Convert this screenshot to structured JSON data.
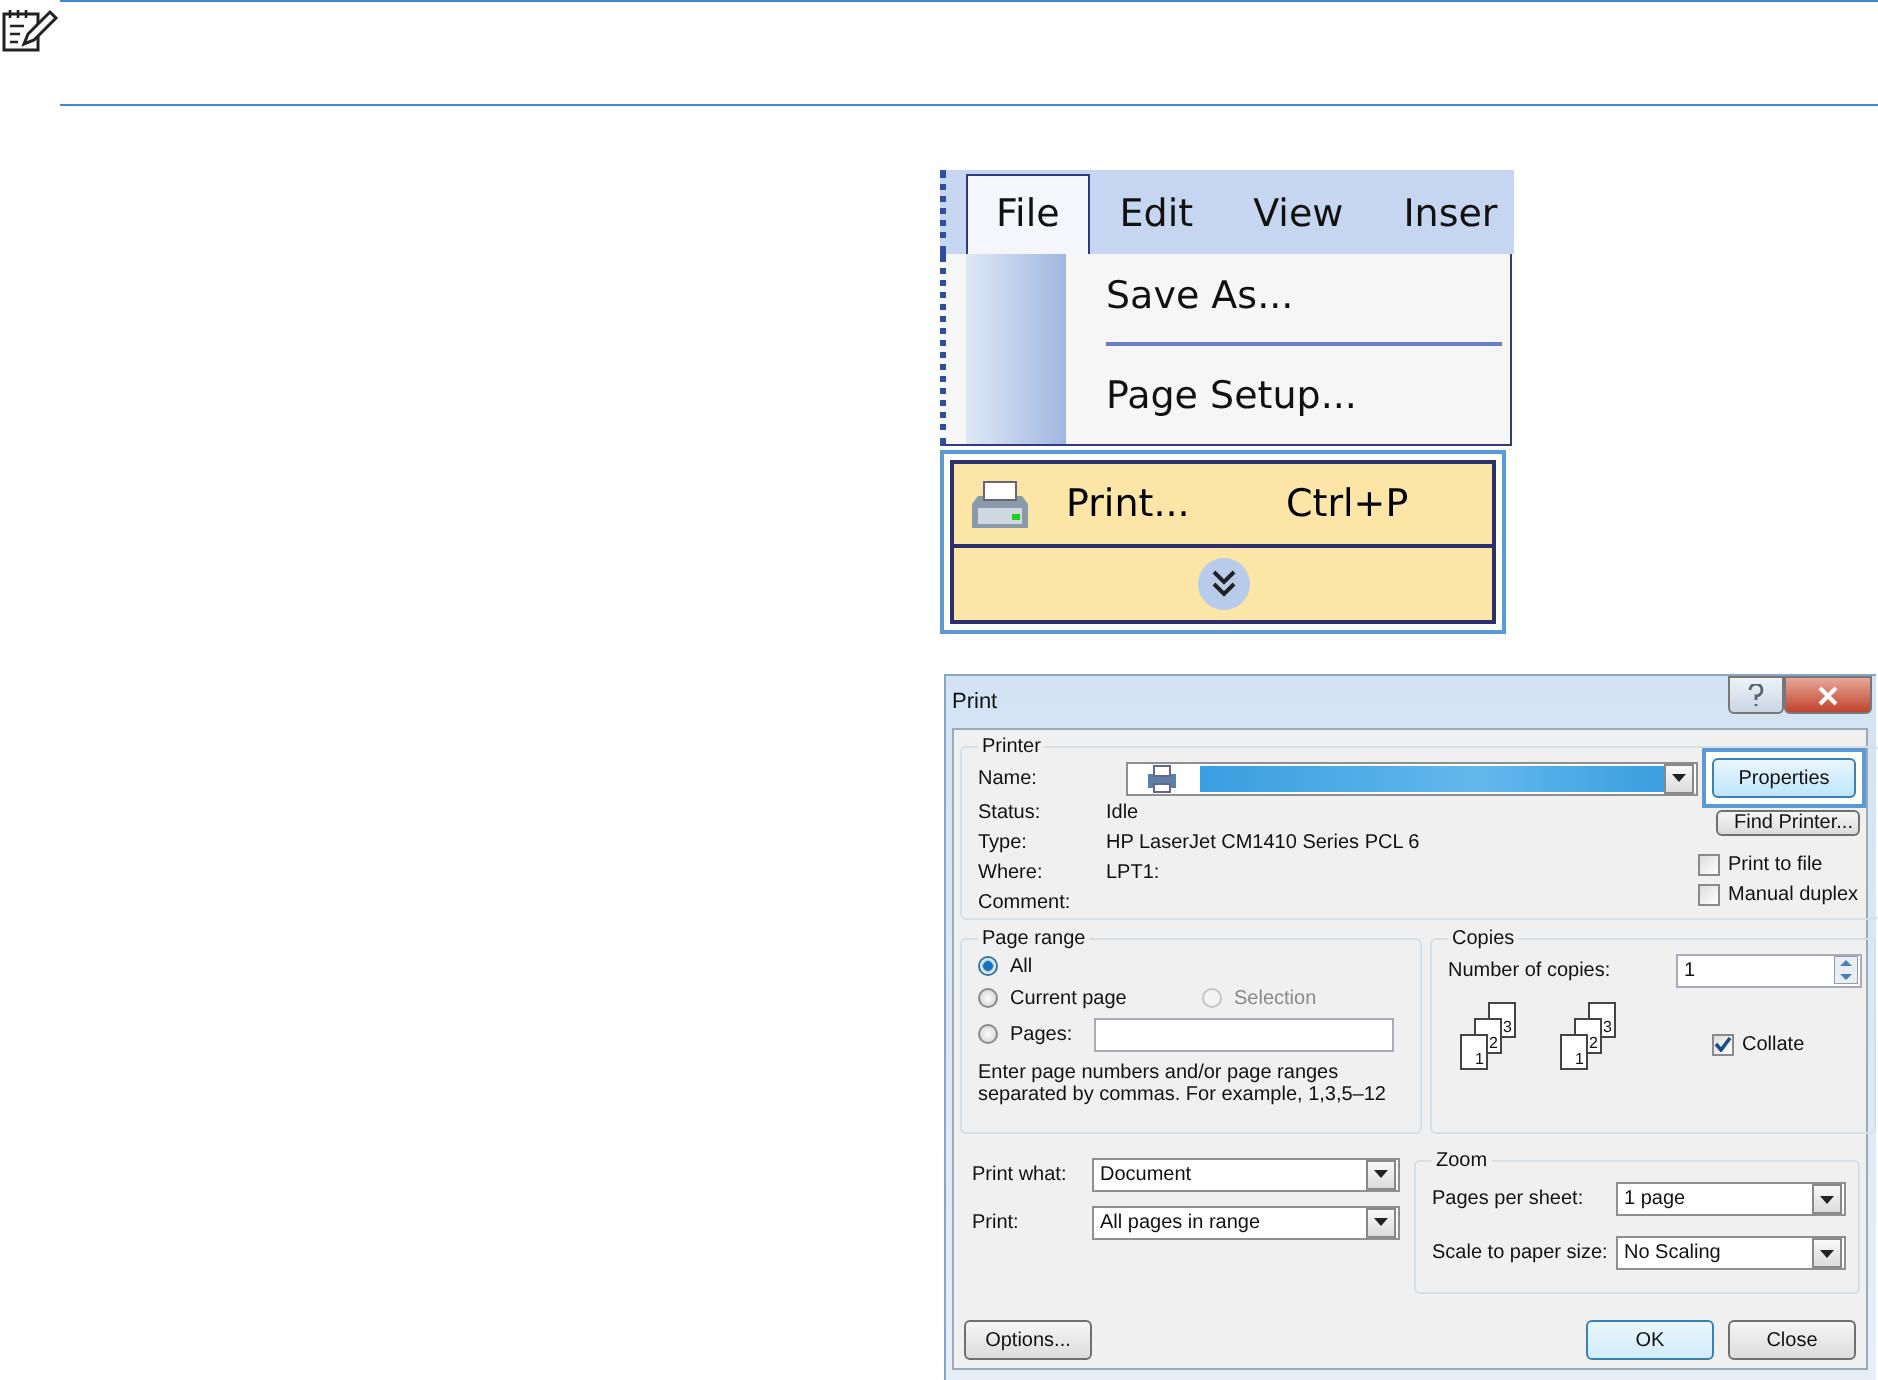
{
  "menu_screenshot": {
    "menu_bar": [
      {
        "label": "File",
        "selected": true
      },
      {
        "label": "Edit",
        "selected": false
      },
      {
        "label": "View",
        "selected": false
      },
      {
        "label": "Inser",
        "selected": false
      }
    ],
    "items": [
      {
        "kind": "item",
        "label": "Save As..."
      },
      {
        "kind": "separator"
      },
      {
        "kind": "item",
        "label": "Page Setup..."
      },
      {
        "kind": "highlighted",
        "label": "Print...",
        "shortcut": "Ctrl+P"
      },
      {
        "kind": "expand"
      }
    ]
  },
  "print_dialog": {
    "title": "Print",
    "printer": {
      "legend": "Printer",
      "name_label": "Name:",
      "status_label": "Status:",
      "status": "Idle",
      "type_label": "Type:",
      "type": "HP LaserJet CM1410 Series PCL 6",
      "where_label": "Where:",
      "where": "LPT1:",
      "comment_label": "Comment:",
      "properties_button": {
        "label": "Properties",
        "highlighted": true
      },
      "find_printer_button": "Find Printer...",
      "checkboxes": [
        {
          "label": "Print to file",
          "checked": false
        },
        {
          "label": "Manual duplex",
          "checked": false
        }
      ]
    },
    "page_range": {
      "legend": "Page range",
      "options": [
        {
          "label": "All",
          "selected": true,
          "disabled": false
        },
        {
          "label": "Current page",
          "selected": false,
          "disabled": false
        },
        {
          "label": "Selection",
          "selected": false,
          "disabled": true
        },
        {
          "label": "Pages:",
          "selected": false,
          "disabled": false
        }
      ],
      "hint": "Enter page numbers and/or page ranges separated by commas.  For example, 1,3,5–12"
    },
    "copies": {
      "legend": "Copies",
      "number_label": "Number of copies:",
      "number": "1",
      "stacks": [
        {
          "pages": [
            "3",
            "2",
            "1"
          ]
        },
        {
          "pages": [
            "3",
            "2",
            "1"
          ]
        }
      ],
      "collate": {
        "label": "Collate",
        "checked": true
      }
    },
    "print_what": {
      "label": "Print what:",
      "value": "Document"
    },
    "print": {
      "label": "Print:",
      "value": "All pages in range"
    },
    "zoom": {
      "legend": "Zoom",
      "pages_per_sheet_label": "Pages per sheet:",
      "pages_per_sheet": "1 page",
      "scale_label": "Scale to paper size:",
      "scale": "No Scaling"
    },
    "buttons": {
      "options": "Options...",
      "ok": "OK",
      "close": "Close"
    }
  }
}
